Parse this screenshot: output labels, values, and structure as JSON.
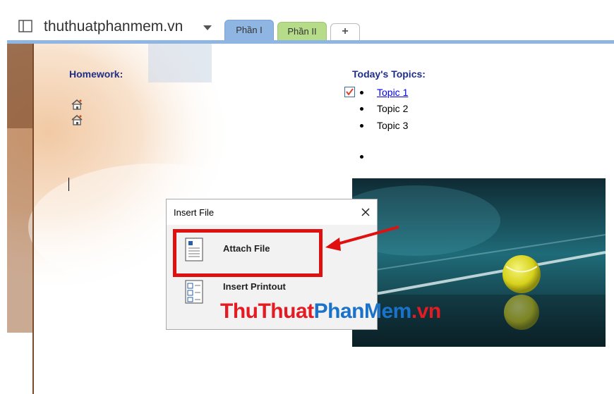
{
  "titlebar": {
    "notebook_name": "thuthuatphanmem.vn",
    "tabs": [
      {
        "label": "Phần I",
        "color": "#8fb6e2"
      },
      {
        "label": "Phần II",
        "color": "#b6dc8a"
      }
    ],
    "add_tab_label": "+"
  },
  "page": {
    "homework_heading": "Homework:",
    "topics_heading": "Today's Topics:",
    "topics": [
      "Topic 1",
      "Topic 2",
      "Topic 3"
    ],
    "checked": true
  },
  "dialog": {
    "title": "Insert File",
    "options": [
      {
        "label": "Attach File",
        "icon": "attach-file-icon"
      },
      {
        "label": "Insert Printout",
        "icon": "insert-printout-icon"
      }
    ]
  },
  "watermark": {
    "part1": "Thu",
    "part2": "Thuat",
    "part3": "PhanMem",
    "part4": ".vn"
  },
  "colors": {
    "heading": "#1f2e86",
    "highlight": "#e01010",
    "accent": "#8fb6e2"
  }
}
